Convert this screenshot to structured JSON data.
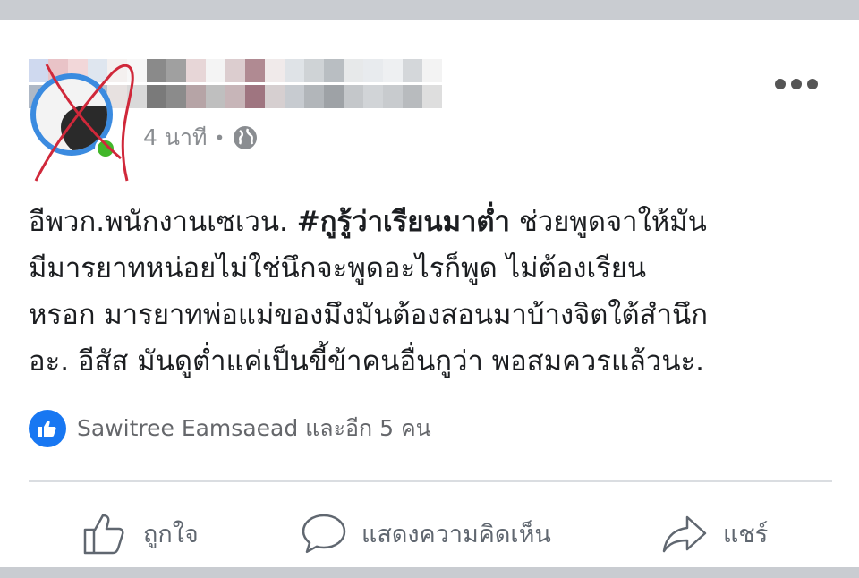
{
  "post": {
    "author_name": "",
    "timestamp": "4 นาที",
    "privacy_icon": "globe-icon",
    "more_icon": "ellipsis-icon",
    "text_lines": [
      {
        "before": "อีพวก.พนักงานเซเวน. ",
        "hashtag": "#กูรู้ว่าเรียนมาต่ำ",
        "after": " ช่วยพูดจาให้มัน"
      },
      {
        "before": "มีมารยาทหน่อยไม่ใช่นึกจะพูดอะไรก็พูด ไม่ต้องเรียน",
        "hashtag": "",
        "after": ""
      },
      {
        "before": "หรอก มารยาทพ่อแม่ของมึงมันต้องสอนมาบ้างจิตใต้สำนึก",
        "hashtag": "",
        "after": ""
      },
      {
        "before": "อะ. อีสัส   มันดูต่ำแค่เป็นขี้ข้าคนอื่นกูว่า พอสมควรแล้วนะ.",
        "hashtag": "",
        "after": ""
      }
    ]
  },
  "reactions": {
    "icon": "thumbs-up-icon",
    "text": "Sawitree Eamsaead และอีก 5 คน",
    "color": "#1877f2"
  },
  "actions": [
    {
      "label": "ถูกใจ",
      "icon": "thumbs-up-outline-icon"
    },
    {
      "label": "แสดงความคิดเห็น",
      "icon": "comment-icon"
    },
    {
      "label": "แชร์",
      "icon": "share-icon"
    }
  ]
}
